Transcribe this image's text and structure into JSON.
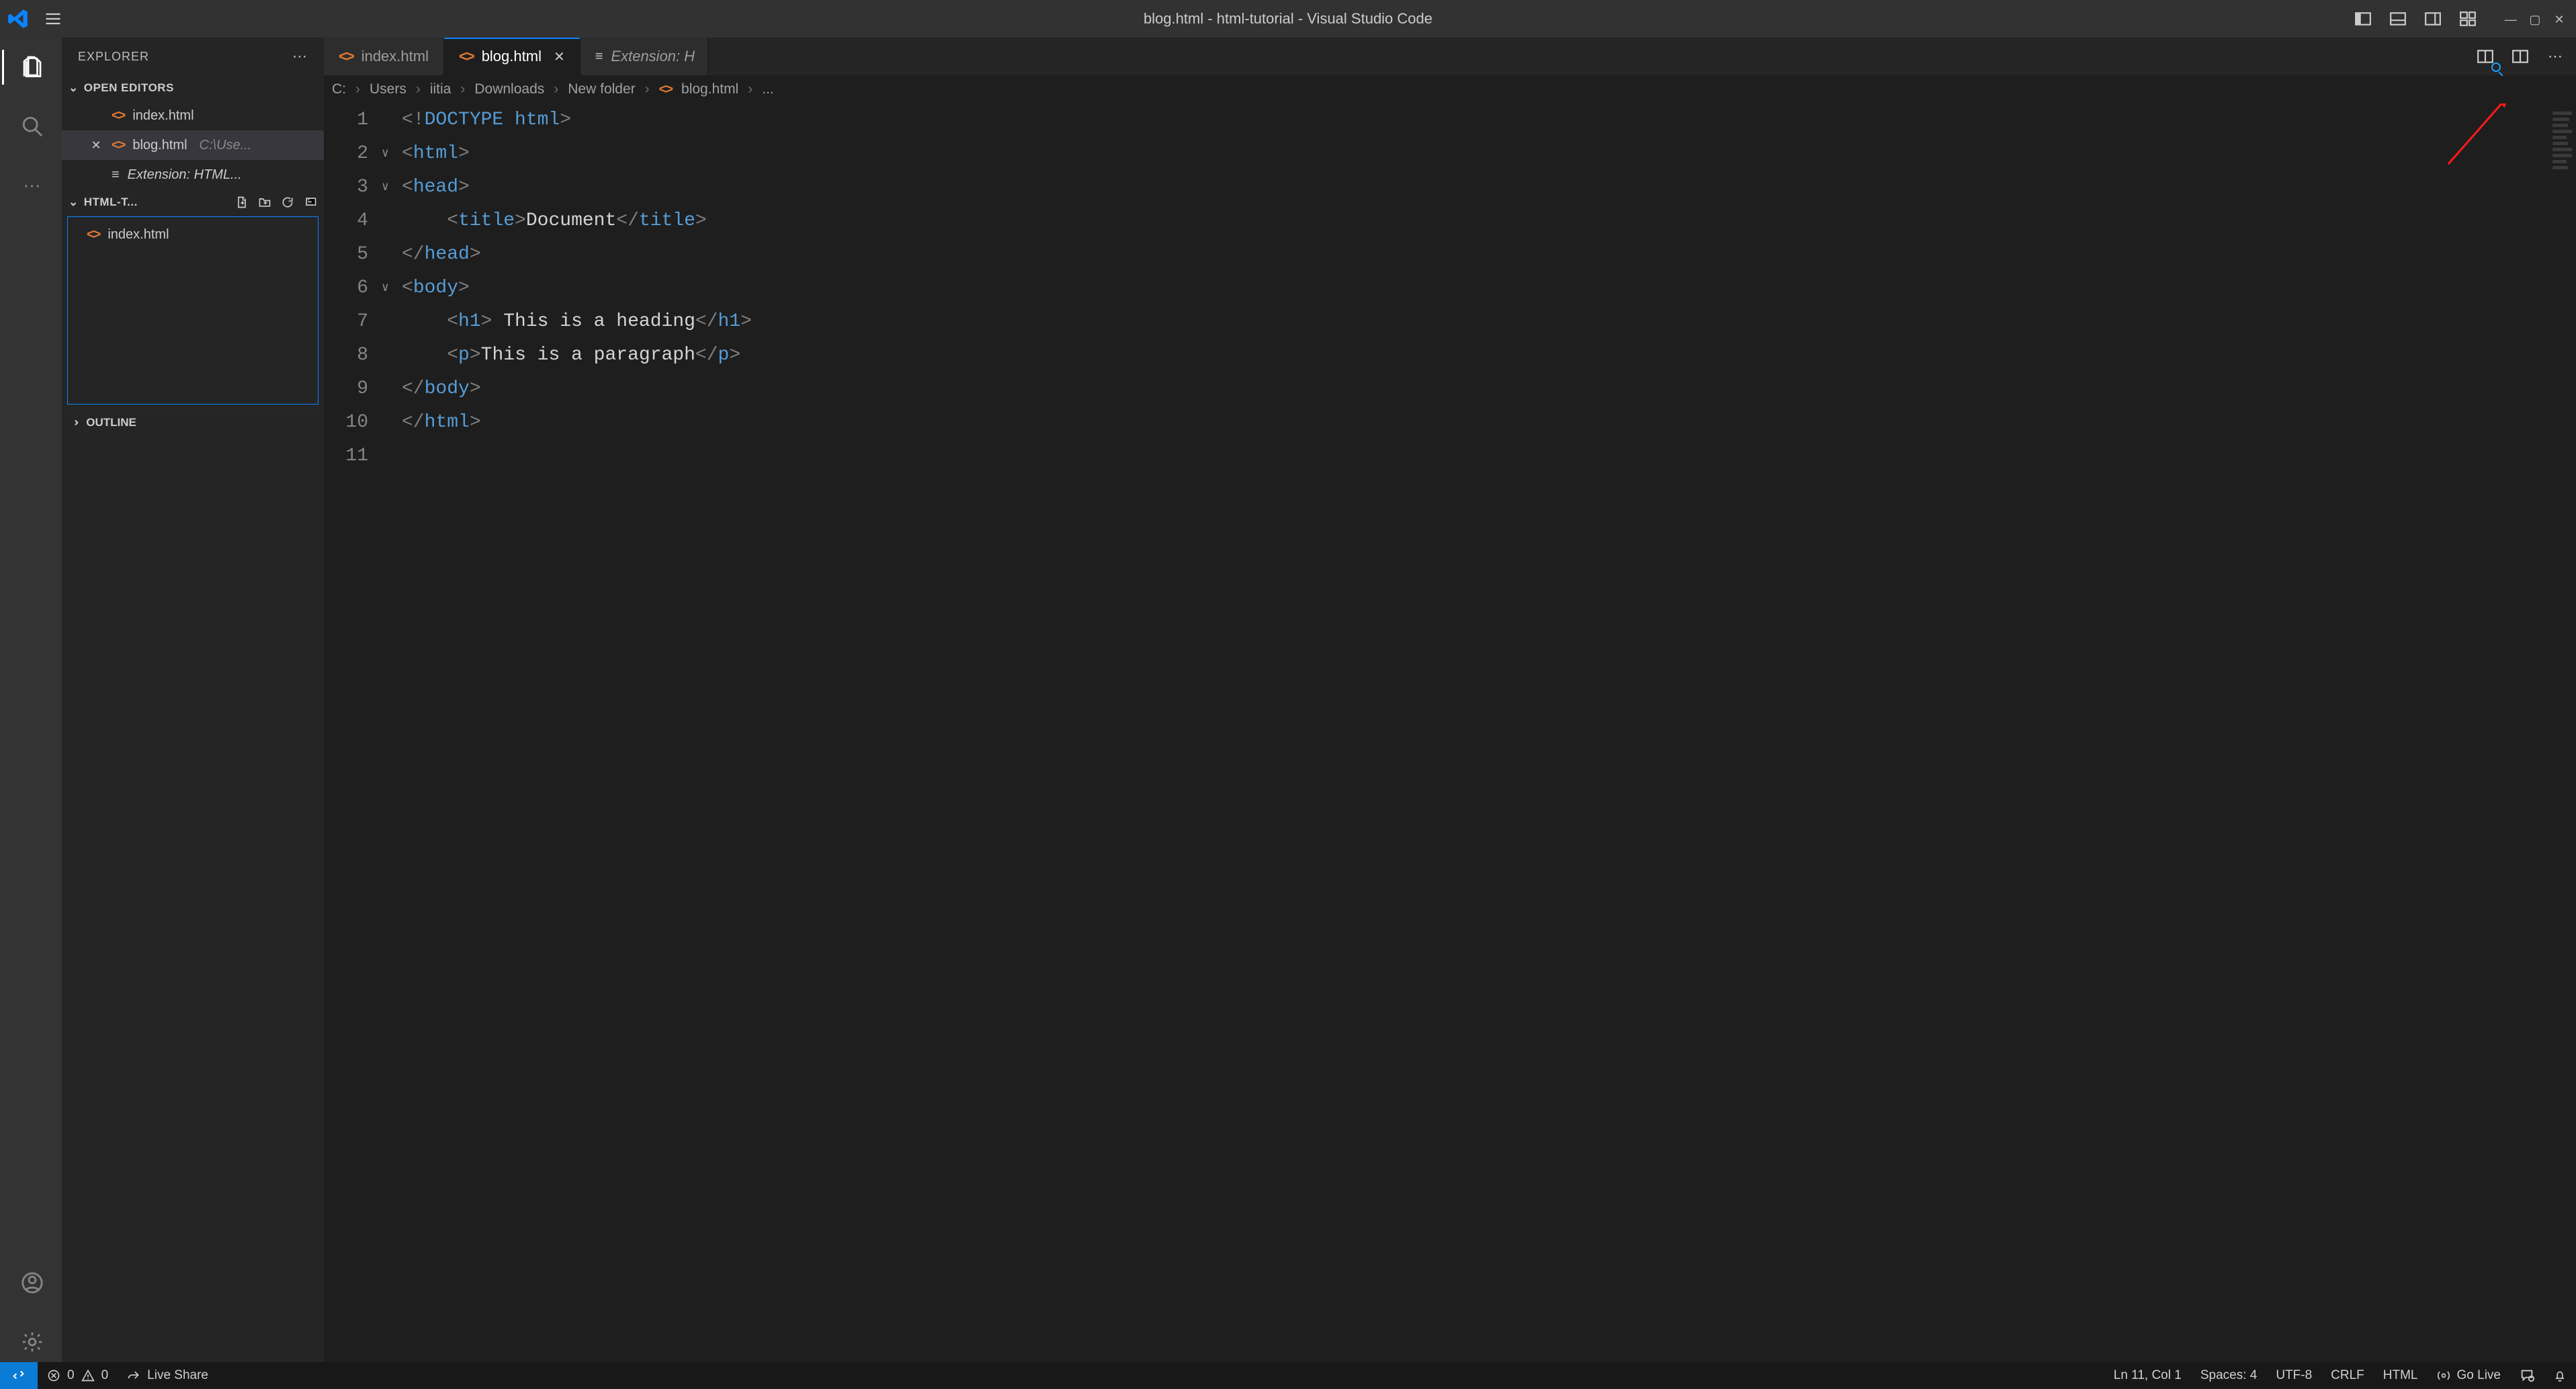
{
  "titlebar": {
    "title": "blog.html - html-tutorial - Visual Studio Code"
  },
  "explorer": {
    "title": "EXPLORER",
    "open_editors_label": "OPEN EDITORS",
    "open_editors": [
      {
        "name": "index.html",
        "kind": "html",
        "active": false,
        "detail": ""
      },
      {
        "name": "blog.html",
        "kind": "html",
        "active": true,
        "detail": "C:\\Use..."
      },
      {
        "name": "Extension: HTML...",
        "kind": "ext",
        "active": false,
        "detail": ""
      }
    ],
    "folder_label": "HTML-T...",
    "files": [
      {
        "name": "index.html",
        "kind": "html"
      }
    ],
    "outline_label": "OUTLINE"
  },
  "tabs": [
    {
      "name": "index.html",
      "kind": "html",
      "active": false
    },
    {
      "name": "blog.html",
      "kind": "html",
      "active": true
    },
    {
      "name": "Extension: H",
      "kind": "ext",
      "active": false
    }
  ],
  "breadcrumbs": [
    "C:",
    "Users",
    "iitia",
    "Downloads",
    "New folder"
  ],
  "breadcrumb_file": "blog.html",
  "breadcrumb_trail": "...",
  "code": {
    "lines": [
      {
        "n": "1",
        "fold": "",
        "tokens": [
          [
            "bracket",
            "<!"
          ],
          [
            "doctype",
            "DOCTYPE "
          ],
          [
            "tag",
            "html"
          ],
          [
            "bracket",
            ">"
          ]
        ]
      },
      {
        "n": "2",
        "fold": "∨",
        "tokens": [
          [
            "bracket",
            "<"
          ],
          [
            "tag",
            "html"
          ],
          [
            "bracket",
            ">"
          ]
        ]
      },
      {
        "n": "3",
        "fold": "∨",
        "tokens": [
          [
            "bracket",
            "<"
          ],
          [
            "tag",
            "head"
          ],
          [
            "bracket",
            ">"
          ]
        ]
      },
      {
        "n": "4",
        "fold": "",
        "indent": 1,
        "tokens": [
          [
            "text",
            "    "
          ],
          [
            "bracket",
            "<"
          ],
          [
            "tag",
            "title"
          ],
          [
            "bracket",
            ">"
          ],
          [
            "text",
            "Document"
          ],
          [
            "bracket",
            "</"
          ],
          [
            "tag",
            "title"
          ],
          [
            "bracket",
            ">"
          ]
        ]
      },
      {
        "n": "5",
        "fold": "",
        "tokens": [
          [
            "bracket",
            "</"
          ],
          [
            "tag",
            "head"
          ],
          [
            "bracket",
            ">"
          ]
        ]
      },
      {
        "n": "6",
        "fold": "∨",
        "tokens": [
          [
            "bracket",
            "<"
          ],
          [
            "tag",
            "body"
          ],
          [
            "bracket",
            ">"
          ]
        ]
      },
      {
        "n": "7",
        "fold": "",
        "indent": 1,
        "tokens": [
          [
            "text",
            "    "
          ],
          [
            "bracket",
            "<"
          ],
          [
            "tag",
            "h1"
          ],
          [
            "bracket",
            ">"
          ],
          [
            "text",
            " This is a heading"
          ],
          [
            "bracket",
            "</"
          ],
          [
            "tag",
            "h1"
          ],
          [
            "bracket",
            ">"
          ]
        ]
      },
      {
        "n": "8",
        "fold": "",
        "indent": 1,
        "tokens": [
          [
            "text",
            "    "
          ],
          [
            "bracket",
            "<"
          ],
          [
            "tag",
            "p"
          ],
          [
            "bracket",
            ">"
          ],
          [
            "text",
            "This is a paragraph"
          ],
          [
            "bracket",
            "</"
          ],
          [
            "tag",
            "p"
          ],
          [
            "bracket",
            ">"
          ]
        ]
      },
      {
        "n": "9",
        "fold": "",
        "tokens": [
          [
            "bracket",
            "</"
          ],
          [
            "tag",
            "body"
          ],
          [
            "bracket",
            ">"
          ]
        ]
      },
      {
        "n": "10",
        "fold": "",
        "tokens": [
          [
            "bracket",
            "</"
          ],
          [
            "tag",
            "html"
          ],
          [
            "bracket",
            ">"
          ]
        ]
      },
      {
        "n": "11",
        "fold": "",
        "tokens": []
      }
    ]
  },
  "status": {
    "errors": "0",
    "warnings": "0",
    "liveshare": "Live Share",
    "cursor": "Ln 11, Col 1",
    "spaces": "Spaces: 4",
    "encoding": "UTF-8",
    "eol": "CRLF",
    "lang": "HTML",
    "golive": "Go Live"
  }
}
